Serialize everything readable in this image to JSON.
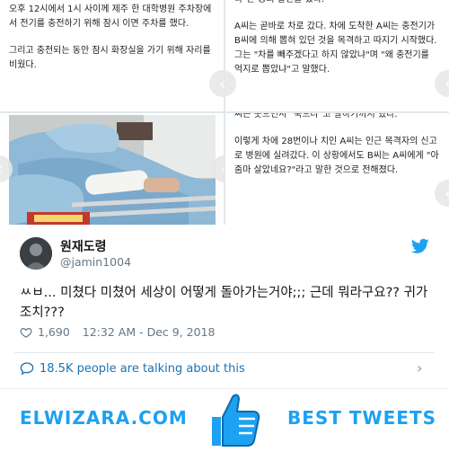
{
  "article": {
    "c1_paragraphs": [
      "오후 12시에서 1시 사이께 제주 한 대학병원 주차장에서 전기를 충전하기 위해 잠시 이면 주차를 했다.",
      "그리고 충전되는 동안 잠시 화장실을 가기 위해 자리를 비웠다."
    ],
    "c2_paragraphs": [
      "다\"는 등의 발언을 했다.",
      "A씨는 곧바로 차로 갔다. 차에 도착한 A씨는 충전기가 B씨에 의해 뽑혀 있던 것을 목격하고 따지기 시작했다. 그는 \"차를 빼주겠다고 하지 않았냐\"며 \"왜 충전기를 억지로 뽑았냐\"고 말했다."
    ],
    "c4_paragraphs": [
      "씨는 웃으면서 \"죽으라\"고 말하기까지 했다.",
      "이렇게 차에 28번이나 치인 A씨는 인근 목격자의 신고로 병원에 실려갔다. 이 상황에서도 B씨는 A씨에게 \"아줌마 살았네요?\"라고 말한 것으로 전해졌다."
    ],
    "nav_glyph": "‹"
  },
  "tweet": {
    "display_name": "원재도령",
    "handle": "@jamin1004",
    "text": "ㅆㅂ... 미쳤다 미쳤어 세상이 어떻게 돌아가는거야;;; 근데 뭐라구요?? 귀가조치???",
    "likes": "1,690",
    "timestamp": "12:32 AM - Dec 9, 2018",
    "talking": "18.5K people are talking about this",
    "chevron": "›"
  },
  "banner": {
    "brand": "ELWIZARA.COM",
    "best": "BEST TWEETS"
  },
  "colors": {
    "twitter_blue": "#1da1f2",
    "link_blue": "#1b73b5",
    "muted": "#657786"
  },
  "icons": {
    "bird": "twitter-bird-icon",
    "heart": "heart-icon",
    "bubble": "speech-bubble-icon",
    "thumb": "thumbs-up-icon",
    "chevron": "chevron-right-icon",
    "nav": "chevron-left-icon"
  }
}
